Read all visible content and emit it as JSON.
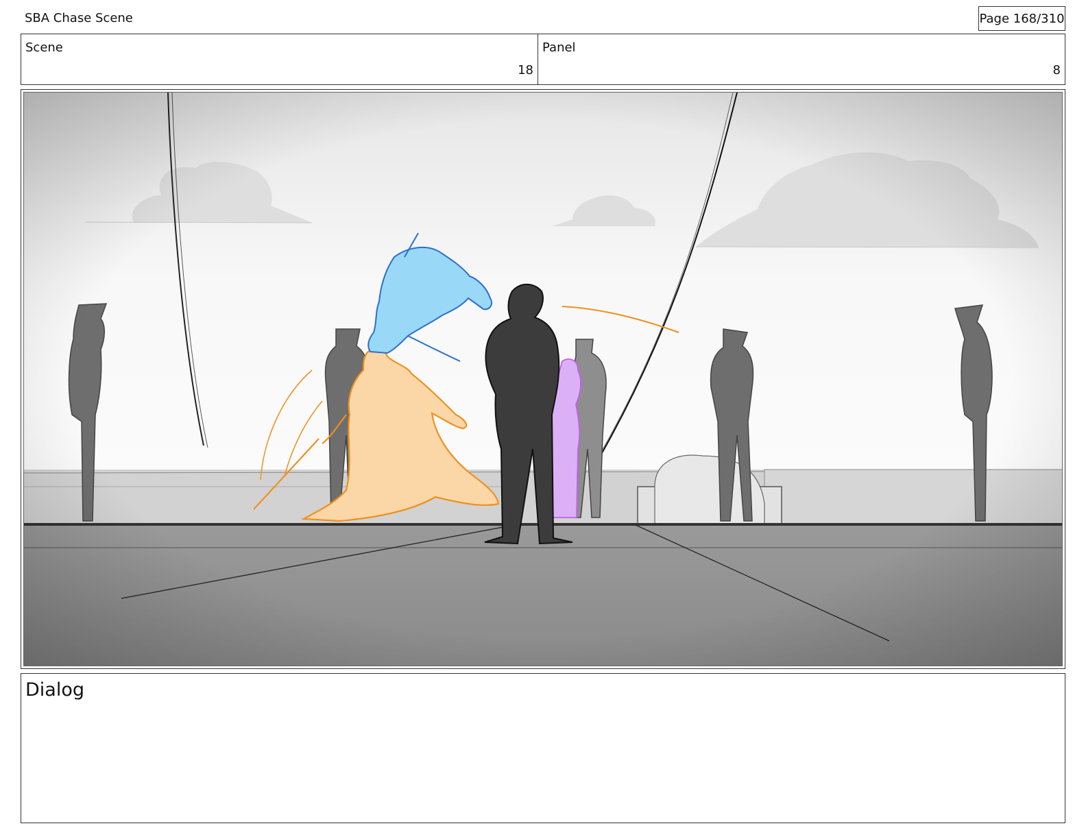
{
  "header": {
    "title": "SBA Chase Scene",
    "page": "Page 168/310"
  },
  "info": {
    "scene_label": "Scene",
    "scene_value": "18",
    "panel_label": "Panel",
    "panel_value": "8"
  },
  "dialog": {
    "label": "Dialog"
  },
  "sketch": {
    "colors": {
      "blue_figure": "#4aa9e8",
      "orange_figure": "#f0901e",
      "purple_figure": "#c060f0",
      "dark_figure": "#3c3c3c",
      "guard_figure": "#6e6e6e"
    }
  }
}
